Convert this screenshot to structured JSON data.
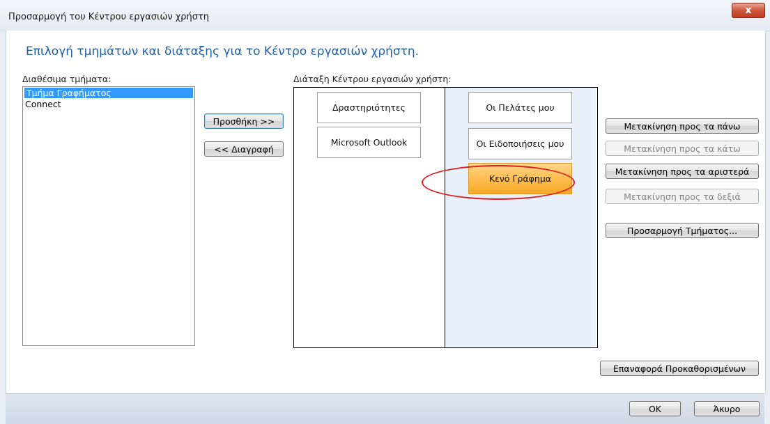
{
  "window": {
    "title": "Προσαρμογή του Κέντρου εργασιών χρήστη",
    "close_glyph": "x"
  },
  "heading": "Επιλογή τμημάτων και διάταξης για το Κέντρο εργασιών χρήστη.",
  "available": {
    "label": "Διαθέσιμα τμήματα:",
    "items": [
      "Τμήμα Γραφήματος",
      "Connect"
    ],
    "selected_index": 0
  },
  "transfer": {
    "add_label": "Προσθήκη >>",
    "remove_label": "<< Διαγραφή"
  },
  "layout": {
    "label": "Διάταξη Κέντρου εργασιών χρήστη:",
    "left_column": [
      "Δραστηριότητες",
      "Microsoft Outlook"
    ],
    "right_column": [
      "Οι Πελάτες μου",
      "Οι Ειδοποιήσεις μου",
      "Κενό Γράφημα"
    ],
    "selected_tile": "Κενό Γράφημα"
  },
  "actions": {
    "move_up": "Μετακίνηση προς τα πάνω",
    "move_down": "Μετακίνηση προς τα κάτω",
    "move_left": "Μετακίνηση προς τα αριστερά",
    "move_right": "Μετακίνηση προς τα δεξιά",
    "customize": "Προσαρμογή Τμήματος...",
    "reset": "Επαναφορά Προκαθορισμένων"
  },
  "footer": {
    "ok_label": "OK",
    "cancel_label": "Άκυρο"
  },
  "colors": {
    "heading": "#1f5fa8",
    "selection": "#3399ff",
    "highlight_ellipse": "#d8201f",
    "tile_selected": "#ffbf55"
  }
}
